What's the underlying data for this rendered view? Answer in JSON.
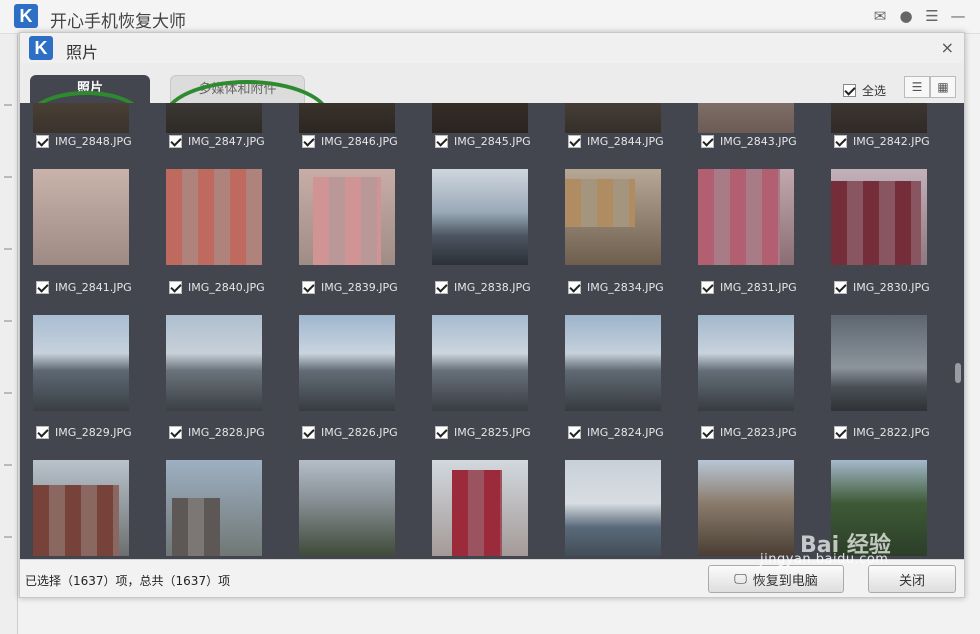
{
  "app": {
    "title": "开心手机恢复大师",
    "logo_letter": "K"
  },
  "dialog": {
    "title": "照片",
    "logo_letter": "K",
    "close_glyph": "×"
  },
  "tabs": [
    {
      "label": "照片",
      "active": true
    },
    {
      "label": "多媒体和附件",
      "active": false
    }
  ],
  "toolbar": {
    "select_all_label": "全选",
    "select_all_checked": true
  },
  "rows": [
    {
      "labels": [
        "IMG_2848.JPG",
        "IMG_2847.JPG",
        "IMG_2846.JPG",
        "IMG_2845.JPG",
        "IMG_2844.JPG",
        "IMG_2843.JPG",
        "IMG_2842.JPG"
      ]
    },
    {
      "labels": [
        "IMG_2841.JPG",
        "IMG_2840.JPG",
        "IMG_2839.JPG",
        "IMG_2838.JPG",
        "IMG_2834.JPG",
        "IMG_2831.JPG",
        "IMG_2830.JPG"
      ]
    },
    {
      "labels": [
        "IMG_2829.JPG",
        "IMG_2828.JPG",
        "IMG_2826.JPG",
        "IMG_2825.JPG",
        "IMG_2824.JPG",
        "IMG_2823.JPG",
        "IMG_2822.JPG"
      ]
    },
    {
      "labels": [
        "",
        "",
        "",
        "",
        "",
        "",
        ""
      ]
    }
  ],
  "footer": {
    "status": "已选择（1637）项，总共（1637）项",
    "restore_label": "恢复到电脑",
    "close_label": "关闭"
  },
  "watermark": {
    "line1": "Bai 经验",
    "line2": "jingyan.baidu.com"
  },
  "colors": {
    "grid_bg": "#43464f",
    "accent_ring": "#2f8a2f",
    "logo_blue": "#2d6fc4"
  }
}
